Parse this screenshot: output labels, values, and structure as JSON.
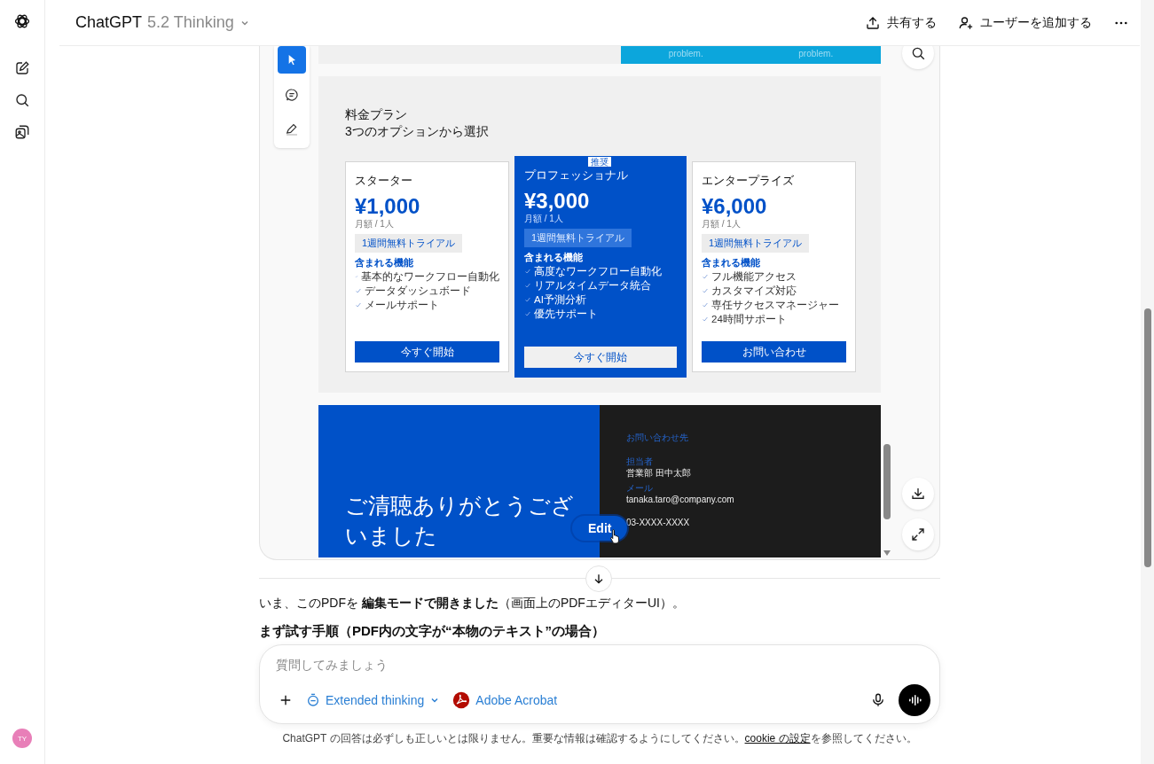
{
  "header": {
    "title": "ChatGPT",
    "model": "5.2 Thinking",
    "actions": [
      {
        "kind": "share",
        "label": "共有する"
      },
      {
        "kind": "add_user",
        "label": "ユーザーを追加する"
      }
    ]
  },
  "sidebar": {
    "avatar": "TY"
  },
  "pdf_viewer": {
    "tools": [
      {
        "kind": "select",
        "selected": true
      },
      {
        "kind": "comment",
        "selected": false
      },
      {
        "kind": "draw",
        "selected": false
      }
    ],
    "top_banner": {
      "texts": [
        "problem.",
        "problem."
      ]
    },
    "pricing_slide": {
      "title_lines": [
        "料金プラン",
        "3つのオプションから選択"
      ],
      "plans": [
        {
          "name": "スターター",
          "price": "¥1,000",
          "period": "月額 / 1人",
          "trial": "1週間無料トライアル",
          "features_heading": "含まれる機能",
          "features": [
            "基本的なワークフロー自動化",
            "データダッシュボード",
            "メールサポート"
          ],
          "button": "今すぐ開始",
          "featured": false
        },
        {
          "name": "プロフェッショナル",
          "price": "¥3,000",
          "period": "月額 / 1人",
          "trial": "1週間無料トライアル",
          "features_heading": "含まれる機能",
          "features": [
            "高度なワークフロー自動化",
            "リアルタイムデータ統合",
            "AI予測分析",
            "優先サポート"
          ],
          "button": "今すぐ開始",
          "featured": true,
          "badge": "推奨"
        },
        {
          "name": "エンタープライズ",
          "price": "¥6,000",
          "period": "月額 / 1人",
          "trial": "1週間無料トライアル",
          "features_heading": "含まれる機能",
          "features": [
            "フル機能アクセス",
            "カスタマイズ対応",
            "専任サクセスマネージャー",
            "24時間サポート"
          ],
          "button": "お問い合わせ",
          "featured": false
        }
      ]
    },
    "closing_slide": {
      "heading": "ご清聴ありがとうございました",
      "contact_title": "お問い合わせ先",
      "fields": [
        {
          "label": "担当者",
          "value": "営業部 田中太郎"
        },
        {
          "label": "メール",
          "value": "tanaka.taro@company.com"
        },
        {
          "value": "03-XXXX-XXXX"
        }
      ]
    },
    "edit_button": "Edit"
  },
  "message": {
    "paragraph": "いま、このPDFを **編集モードで開きました**（画面上のPDFエディターUI）。",
    "heading": "まず試す手順（PDF内の文字が“本物のテキスト”の場合）"
  },
  "composer": {
    "placeholder": "質問してみましょう",
    "mode": "Extended thinking",
    "app": "Adobe Acrobat"
  },
  "footer": {
    "text": "ChatGPT の回答は必ずしも正しいとは限りません。重要な情報は確認するようにしてください。",
    "link": "cookie の設定",
    "suffix": "を参照してください。"
  }
}
